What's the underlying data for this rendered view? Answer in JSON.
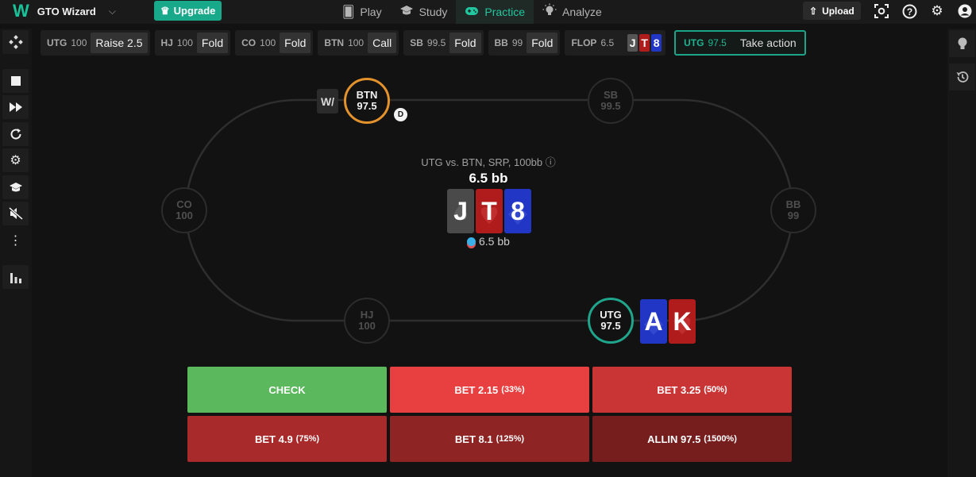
{
  "topbar": {
    "logo": "W",
    "app_name": "GTO Wizard",
    "upgrade_label": "Upgrade",
    "nav": [
      {
        "label": "Play",
        "icon": "cards-icon"
      },
      {
        "label": "Study",
        "icon": "graduation-cap-icon"
      },
      {
        "label": "Practice",
        "icon": "gamepad-icon",
        "active": true
      },
      {
        "label": "Analyze",
        "icon": "lightbulb-icon"
      }
    ],
    "upload_label": "Upload"
  },
  "action_history": [
    {
      "pos": "UTG",
      "stack": "100",
      "move": "Raise 2.5"
    },
    {
      "pos": "HJ",
      "stack": "100",
      "move": "Fold"
    },
    {
      "pos": "CO",
      "stack": "100",
      "move": "Fold"
    },
    {
      "pos": "BTN",
      "stack": "100",
      "move": "Call"
    },
    {
      "pos": "SB",
      "stack": "99.5",
      "move": "Fold"
    },
    {
      "pos": "BB",
      "stack": "99",
      "move": "Fold"
    }
  ],
  "flop": {
    "label": "FLOP",
    "pot": "6.5",
    "cards": [
      "J",
      "T",
      "8"
    ]
  },
  "current": {
    "pos": "UTG",
    "stack": "97.5",
    "text": "Take action"
  },
  "table": {
    "scenario": "UTG vs. BTN, SRP, 100bb ⓘ",
    "pot": "6.5 bb",
    "board": [
      "J",
      "T",
      "8"
    ],
    "chips": "6.5 bb",
    "dealer": "D",
    "badge": "W/",
    "seats": {
      "btn": {
        "pos": "BTN",
        "stack": "97.5"
      },
      "sb": {
        "pos": "SB",
        "stack": "99.5"
      },
      "co": {
        "pos": "CO",
        "stack": "100"
      },
      "bb": {
        "pos": "BB",
        "stack": "99"
      },
      "hj": {
        "pos": "HJ",
        "stack": "100"
      },
      "utg": {
        "pos": "UTG",
        "stack": "97.5"
      }
    },
    "hero_cards": [
      "A",
      "K"
    ]
  },
  "actions": [
    {
      "label": "CHECK",
      "pct": "",
      "color": "#5cb85c"
    },
    {
      "label": "BET 2.15",
      "pct": "(33%)",
      "color": "#e84040"
    },
    {
      "label": "BET 3.25",
      "pct": "(50%)",
      "color": "#c93434"
    },
    {
      "label": "BET 4.9",
      "pct": "(75%)",
      "color": "#a92a2a"
    },
    {
      "label": "BET 8.1",
      "pct": "(125%)",
      "color": "#8e2424"
    },
    {
      "label": "ALLIN 97.5",
      "pct": "(1500%)",
      "color": "#761e1e"
    }
  ],
  "colors": {
    "accent": "#1fa58b",
    "button_ring": "#e3922c",
    "spade_card": "#555555",
    "heart_card": "#b01c1c",
    "diamond_card": "#2236c6",
    "club_card": "#2a8a3a"
  }
}
